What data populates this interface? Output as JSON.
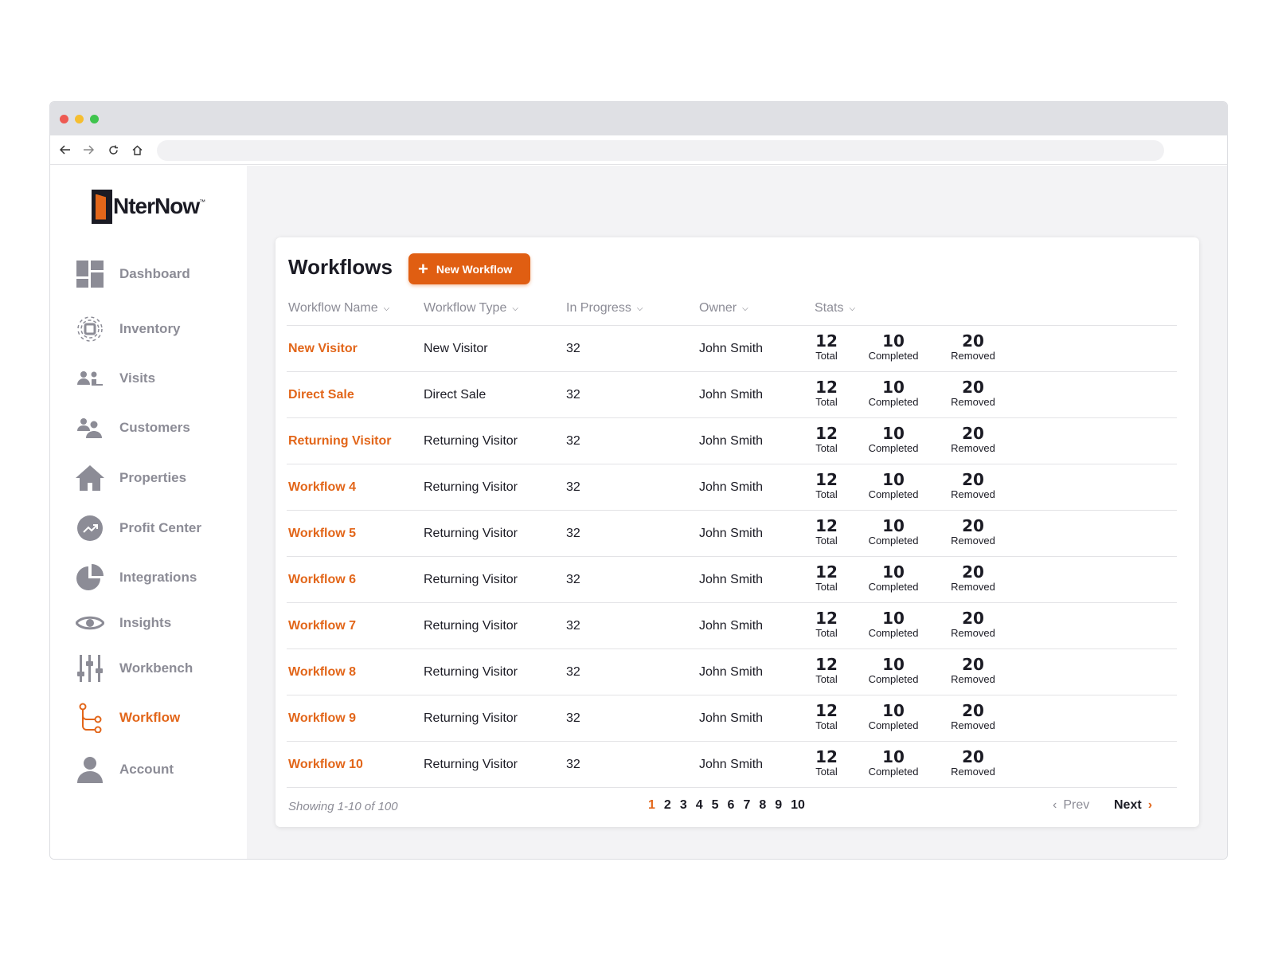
{
  "browser": {
    "url": ""
  },
  "brand": {
    "name": "NterNow",
    "tm": "™"
  },
  "sidebar": {
    "items": [
      {
        "label": "Dashboard",
        "icon": "dashboard-icon"
      },
      {
        "label": "Inventory",
        "icon": "inventory-icon"
      },
      {
        "label": "Visits",
        "icon": "visits-icon"
      },
      {
        "label": "Customers",
        "icon": "customers-icon"
      },
      {
        "label": "Properties",
        "icon": "home-icon"
      },
      {
        "label": "Profit Center",
        "icon": "trending-up-icon"
      },
      {
        "label": "Integrations",
        "icon": "pie-chart-icon"
      },
      {
        "label": "Insights",
        "icon": "eye-icon"
      },
      {
        "label": "Workbench",
        "icon": "sliders-icon"
      },
      {
        "label": "Workflow",
        "icon": "workflow-icon",
        "active": true
      },
      {
        "label": "Account",
        "icon": "user-icon"
      }
    ]
  },
  "main": {
    "title": "Workflows",
    "new_button": "New Workflow",
    "columns": [
      "Workflow Name",
      "Workflow Type",
      "In Progress",
      "Owner",
      "Stats"
    ],
    "stat_labels": [
      "Total",
      "Completed",
      "Removed"
    ],
    "rows": [
      {
        "name": "New Visitor",
        "type": "New Visitor",
        "in_progress": "32",
        "owner": "John Smith",
        "total": "12",
        "completed": "10",
        "removed": "20"
      },
      {
        "name": "Direct Sale",
        "type": "Direct Sale",
        "in_progress": "32",
        "owner": "John Smith",
        "total": "12",
        "completed": "10",
        "removed": "20"
      },
      {
        "name": "Returning Visitor",
        "type": "Returning Visitor",
        "in_progress": "32",
        "owner": "John Smith",
        "total": "12",
        "completed": "10",
        "removed": "20"
      },
      {
        "name": "Workflow 4",
        "type": "Returning Visitor",
        "in_progress": "32",
        "owner": "John Smith",
        "total": "12",
        "completed": "10",
        "removed": "20"
      },
      {
        "name": "Workflow 5",
        "type": "Returning Visitor",
        "in_progress": "32",
        "owner": "John Smith",
        "total": "12",
        "completed": "10",
        "removed": "20"
      },
      {
        "name": "Workflow 6",
        "type": "Returning Visitor",
        "in_progress": "32",
        "owner": "John Smith",
        "total": "12",
        "completed": "10",
        "removed": "20"
      },
      {
        "name": "Workflow 7",
        "type": "Returning Visitor",
        "in_progress": "32",
        "owner": "John Smith",
        "total": "12",
        "completed": "10",
        "removed": "20"
      },
      {
        "name": "Workflow 8",
        "type": "Returning Visitor",
        "in_progress": "32",
        "owner": "John Smith",
        "total": "12",
        "completed": "10",
        "removed": "20"
      },
      {
        "name": "Workflow 9",
        "type": "Returning Visitor",
        "in_progress": "32",
        "owner": "John Smith",
        "total": "12",
        "completed": "10",
        "removed": "20"
      },
      {
        "name": "Workflow 10",
        "type": "Returning Visitor",
        "in_progress": "32",
        "owner": "John Smith",
        "total": "12",
        "completed": "10",
        "removed": "20"
      }
    ],
    "footer": {
      "showing": "Showing 1-10 of 100",
      "pages": [
        "1",
        "2",
        "3",
        "4",
        "5",
        "6",
        "7",
        "8",
        "9",
        "10"
      ],
      "current_page": "1",
      "prev": "Prev",
      "next": "Next"
    }
  },
  "colors": {
    "accent": "#e2661a",
    "text": "#1b1b24",
    "muted": "#8c8c96"
  }
}
